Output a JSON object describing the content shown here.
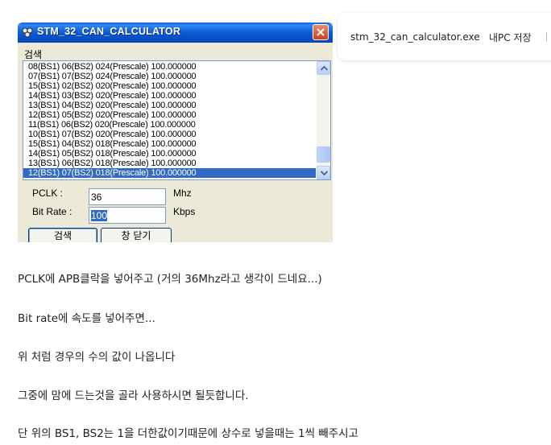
{
  "window": {
    "title": "STM_32_CAN_CALCULATOR",
    "menu_label": "검색",
    "list_rows": [
      "08(BS1) 06(BS2) 024(Prescale) 100.000000",
      "07(BS1) 07(BS2) 024(Prescale) 100.000000",
      "15(BS1) 02(BS2) 020(Prescale) 100.000000",
      "14(BS1) 03(BS2) 020(Prescale) 100.000000",
      "13(BS1) 04(BS2) 020(Prescale) 100.000000",
      "12(BS1) 05(BS2) 020(Prescale) 100.000000",
      "11(BS1) 06(BS2) 020(Prescale) 100.000000",
      "10(BS1) 07(BS2) 020(Prescale) 100.000000",
      "15(BS1) 04(BS2) 018(Prescale) 100.000000",
      "14(BS1) 05(BS2) 018(Prescale) 100.000000",
      "13(BS1) 06(BS2) 018(Prescale) 100.000000",
      "12(BS1) 07(BS2) 018(Prescale) 100.000000"
    ],
    "pclk_label": "PCLK :",
    "pclk_value": "36",
    "pclk_unit": "Mhz",
    "bitrate_label": "Bit Rate :",
    "bitrate_value": "100",
    "bitrate_unit": "Kbps",
    "search_button": "검색",
    "close_window_button": "창 닫기"
  },
  "download": {
    "filename": "stm_32_can_calculator.exe",
    "save_label": "내PC 저장"
  },
  "article": {
    "paragraphs": [
      "PCLK에 APB클락을 넣어주고 (거의 36Mhz라고 생각이 드네요...)",
      "Bit rate에 속도를 넣어주면...",
      "위 처럼 경우의 수의 값이 나옵니다",
      "그중에 맘에 드는것을 골라 사용하시면 될듯합니다.",
      "단 위의 BS1, BS2는 1을 더한값이기때문에 상수로 넣을때는 1씩 빼주시고"
    ]
  },
  "colors": {
    "titlebar": "#0a58d0",
    "selection": "#316ac5",
    "window_face": "#ece9d8",
    "close_button": "#c8411f"
  },
  "icons": [
    "app-icon",
    "close-icon",
    "scroll-up-arrow-icon",
    "scroll-down-arrow-icon"
  ]
}
